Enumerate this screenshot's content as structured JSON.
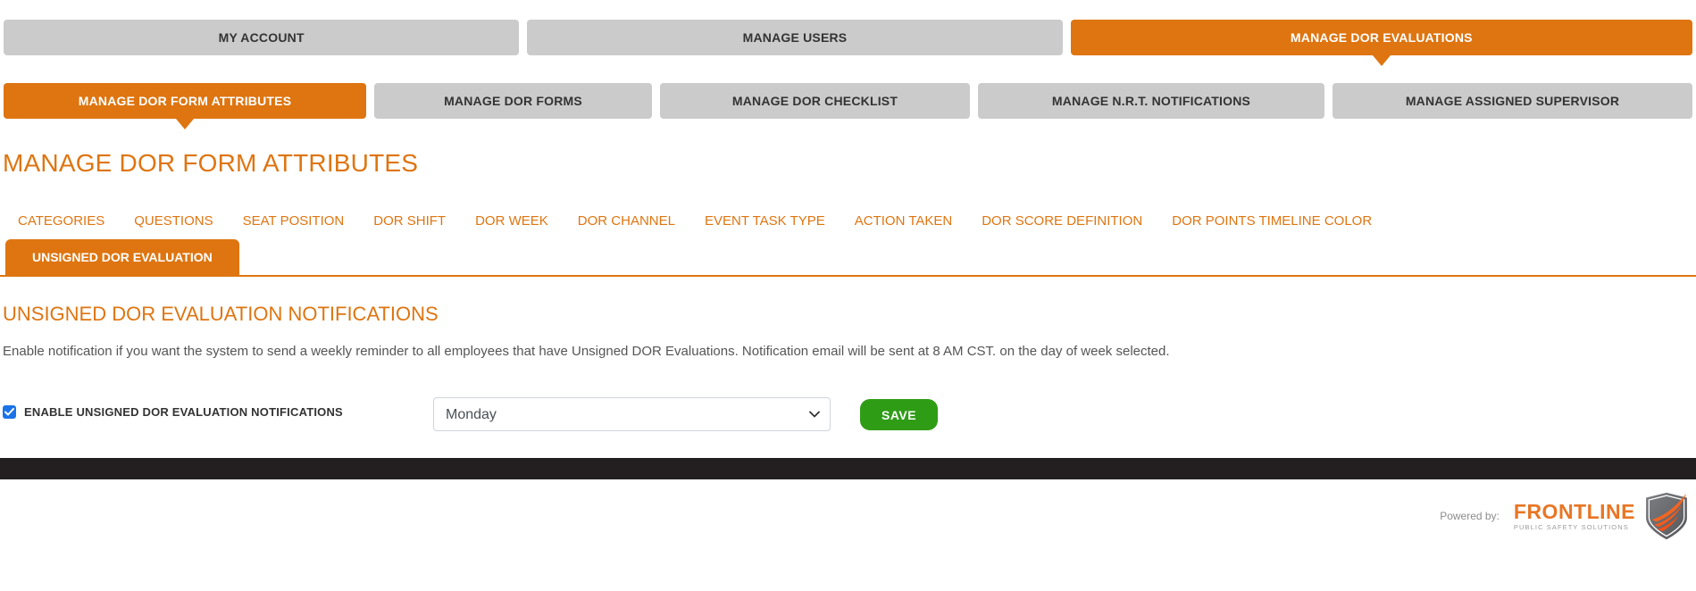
{
  "nav_primary": {
    "items": [
      {
        "label": "MY ACCOUNT",
        "active": false
      },
      {
        "label": "MANAGE USERS",
        "active": false
      },
      {
        "label": "MANAGE DOR EVALUATIONS",
        "active": true
      }
    ]
  },
  "nav_secondary": {
    "items": [
      {
        "label": "MANAGE DOR FORM ATTRIBUTES",
        "active": true
      },
      {
        "label": "MANAGE DOR FORMS",
        "active": false
      },
      {
        "label": "MANAGE DOR CHECKLIST",
        "active": false
      },
      {
        "label": "MANAGE N.R.T. NOTIFICATIONS",
        "active": false
      },
      {
        "label": "MANAGE ASSIGNED SUPERVISOR",
        "active": false
      }
    ]
  },
  "page": {
    "title": "MANAGE DOR FORM ATTRIBUTES"
  },
  "attribute_tabs": {
    "links": [
      "CATEGORIES",
      "QUESTIONS",
      "SEAT POSITION",
      "DOR SHIFT",
      "DOR WEEK",
      "DOR CHANNEL",
      "EVENT TASK TYPE",
      "ACTION TAKEN",
      "DOR SCORE DEFINITION",
      "DOR POINTS TIMELINE COLOR"
    ],
    "active_tab": "UNSIGNED DOR EVALUATION"
  },
  "section": {
    "heading": "UNSIGNED DOR EVALUATION NOTIFICATIONS",
    "description": "Enable notification if you want the system to send a weekly reminder to all employees that have Unsigned DOR Evaluations. Notification email will be sent at 8 AM CST. on the day of week selected."
  },
  "form": {
    "checkbox": {
      "checked": true,
      "label": "ENABLE UNSIGNED DOR EVALUATION NOTIFICATIONS"
    },
    "day_select": {
      "value": "Monday"
    },
    "save_label": "SAVE"
  },
  "footer": {
    "powered_by": "Powered by:",
    "brand": {
      "name": "FRONTLINE",
      "tagline": "PUBLIC SAFETY SOLUTIONS"
    }
  },
  "colors": {
    "accent_orange": "#de7511",
    "nav_gray": "#cbcbcb",
    "nav_text": "#333333",
    "save_green": "#2f9c16",
    "checkbox_blue": "#1a73e8",
    "footer_dark": "#231f20",
    "body_text": "#555555",
    "select_border": "#ced4da",
    "select_text": "#495057",
    "brand_orange": "#e87625"
  }
}
